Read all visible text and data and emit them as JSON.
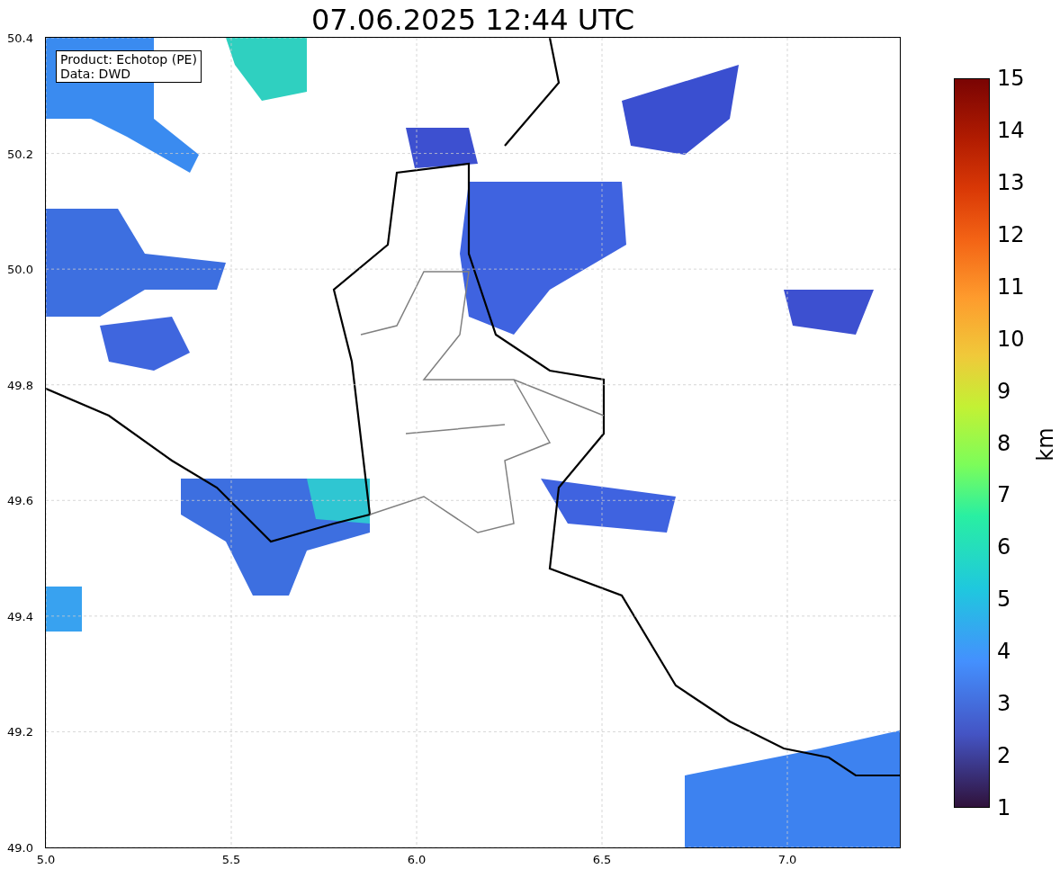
{
  "title": "07.06.2025 12:44 UTC",
  "map": {
    "x_ticks": [
      "5.0",
      "5.5",
      "6.0",
      "6.5",
      "7.0"
    ],
    "y_ticks": [
      "50.4",
      "50.2",
      "50.0",
      "49.8",
      "49.6",
      "49.4",
      "49.2",
      "49.0"
    ],
    "legend": [
      "Product: Echotop (PE)",
      "Data: DWD"
    ]
  },
  "colorbar": {
    "ticks": [
      "15",
      "14",
      "13",
      "12",
      "11",
      "10",
      "9",
      "8",
      "7",
      "6",
      "5",
      "4",
      "3",
      "2",
      "1"
    ],
    "label": "km"
  }
}
